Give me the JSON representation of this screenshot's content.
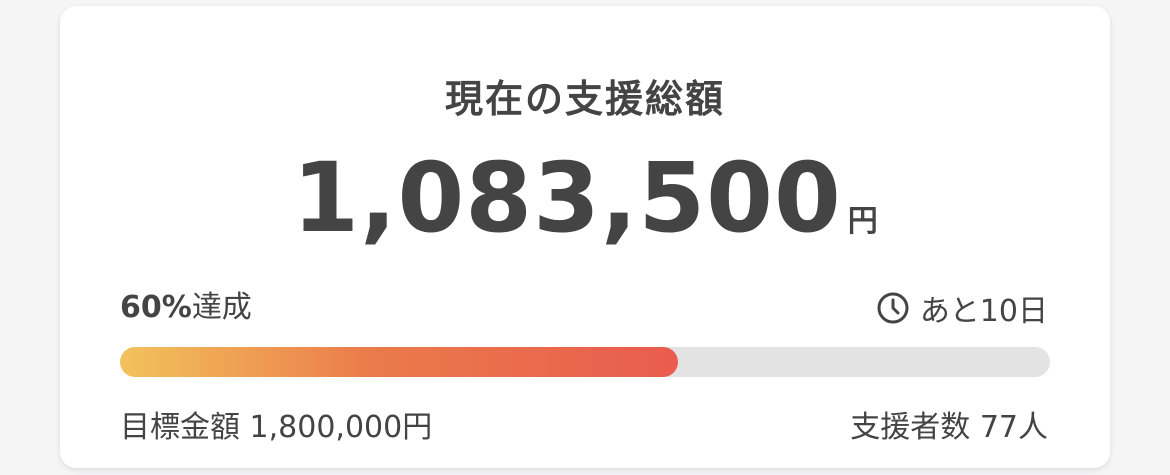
{
  "funding": {
    "title": "現在の支援総額",
    "amount": "1,083,500",
    "currency": "円",
    "achievement_percent": "60%",
    "achievement_suffix": "達成",
    "progress_fraction": 0.6,
    "remaining_label": "あと10日",
    "goal_label": "目標金額",
    "goal_amount": "1,800,000円",
    "supporters_label": "支援者数",
    "supporters_count": "77人"
  },
  "icons": {
    "clock": "clock-icon"
  },
  "colors": {
    "progress_start": "#f3c25c",
    "progress_end": "#e95c4f",
    "track": "#e3e3e3",
    "text": "#444444"
  }
}
